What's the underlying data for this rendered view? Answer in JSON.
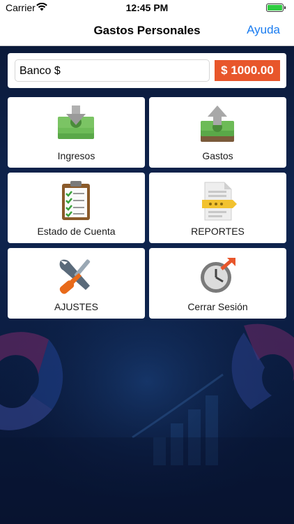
{
  "status_bar": {
    "carrier": "Carrier",
    "time": "12:45 PM"
  },
  "nav": {
    "title": "Gastos Personales",
    "help_label": "Ayuda"
  },
  "balance": {
    "label": "Banco $",
    "amount": "$ 1000.00",
    "amount_color": "#e8562b"
  },
  "tiles": [
    {
      "label": "Ingresos",
      "icon": "money-in-icon"
    },
    {
      "label": "Gastos",
      "icon": "money-out-icon"
    },
    {
      "label": "Estado de Cuenta",
      "icon": "clipboard-checklist-icon"
    },
    {
      "label": "REPORTES",
      "icon": "report-document-icon"
    },
    {
      "label": "AJUSTES",
      "icon": "tools-icon"
    },
    {
      "label": "Cerrar Sesión",
      "icon": "logout-clock-icon"
    }
  ],
  "colors": {
    "accent": "#1a7cf0",
    "background": "#0b1730"
  }
}
